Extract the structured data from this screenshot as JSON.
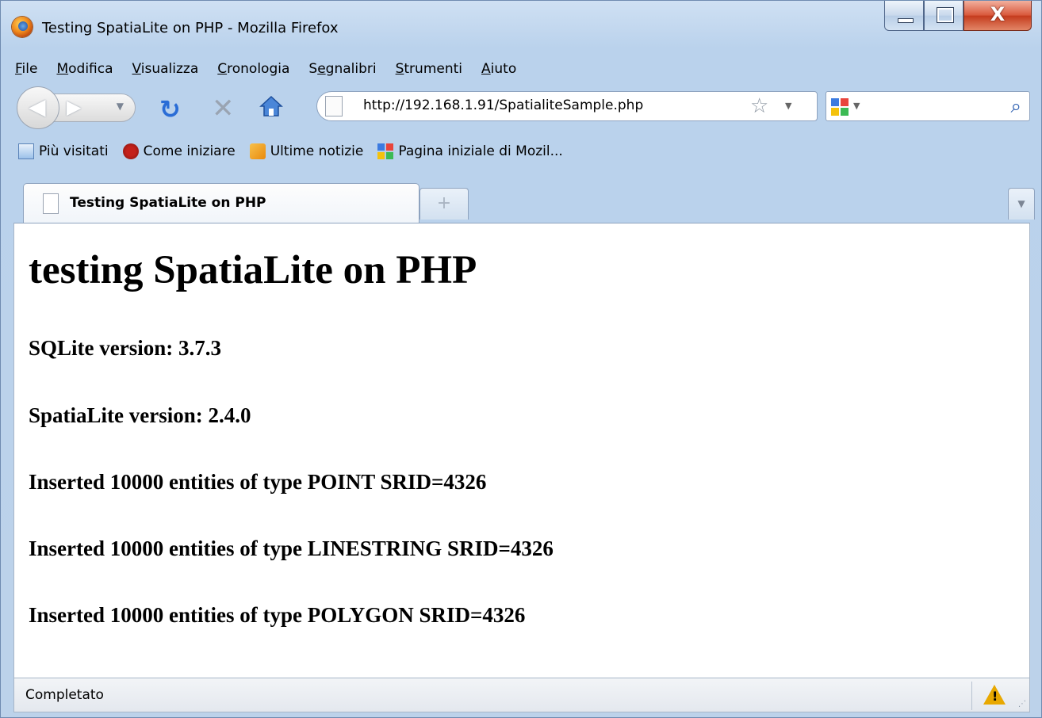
{
  "window": {
    "title": "Testing SpatiaLite on PHP - Mozilla Firefox",
    "close_glyph": "X"
  },
  "menu": [
    {
      "accel": "F",
      "rest": "ile"
    },
    {
      "accel": "M",
      "rest": "odifica"
    },
    {
      "accel": "V",
      "rest": "isualizza"
    },
    {
      "accel": "C",
      "rest": "ronologia"
    },
    {
      "pre": "S",
      "accel": "e",
      "rest": "gnalibri"
    },
    {
      "accel": "S",
      "rest": "trumenti"
    },
    {
      "accel": "A",
      "rest": "iuto"
    }
  ],
  "navbar": {
    "url": "http://192.168.1.91/SpatialiteSample.php",
    "search_value": ""
  },
  "bookmarks": [
    {
      "label": "Più visitati",
      "icon": "most-visited-icon"
    },
    {
      "label": "Come iniziare",
      "icon": "firefox-icon"
    },
    {
      "label": "Ultime notizie",
      "icon": "rss-icon"
    },
    {
      "label": "Pagina iniziale di Mozil...",
      "icon": "mozilla-icon"
    }
  ],
  "tabs": {
    "active_label": "Testing SpatiaLite on PHP",
    "new_tab_glyph": "+"
  },
  "page": {
    "heading": "testing SpatiaLite on PHP",
    "lines": [
      "SQLite version: 3.7.3",
      "SpatiaLite version: 2.4.0",
      "Inserted 10000 entities of type POINT SRID=4326",
      "Inserted 10000 entities of type LINESTRING SRID=4326",
      "Inserted 10000 entities of type POLYGON SRID=4326"
    ]
  },
  "status": {
    "text": "Completato"
  }
}
